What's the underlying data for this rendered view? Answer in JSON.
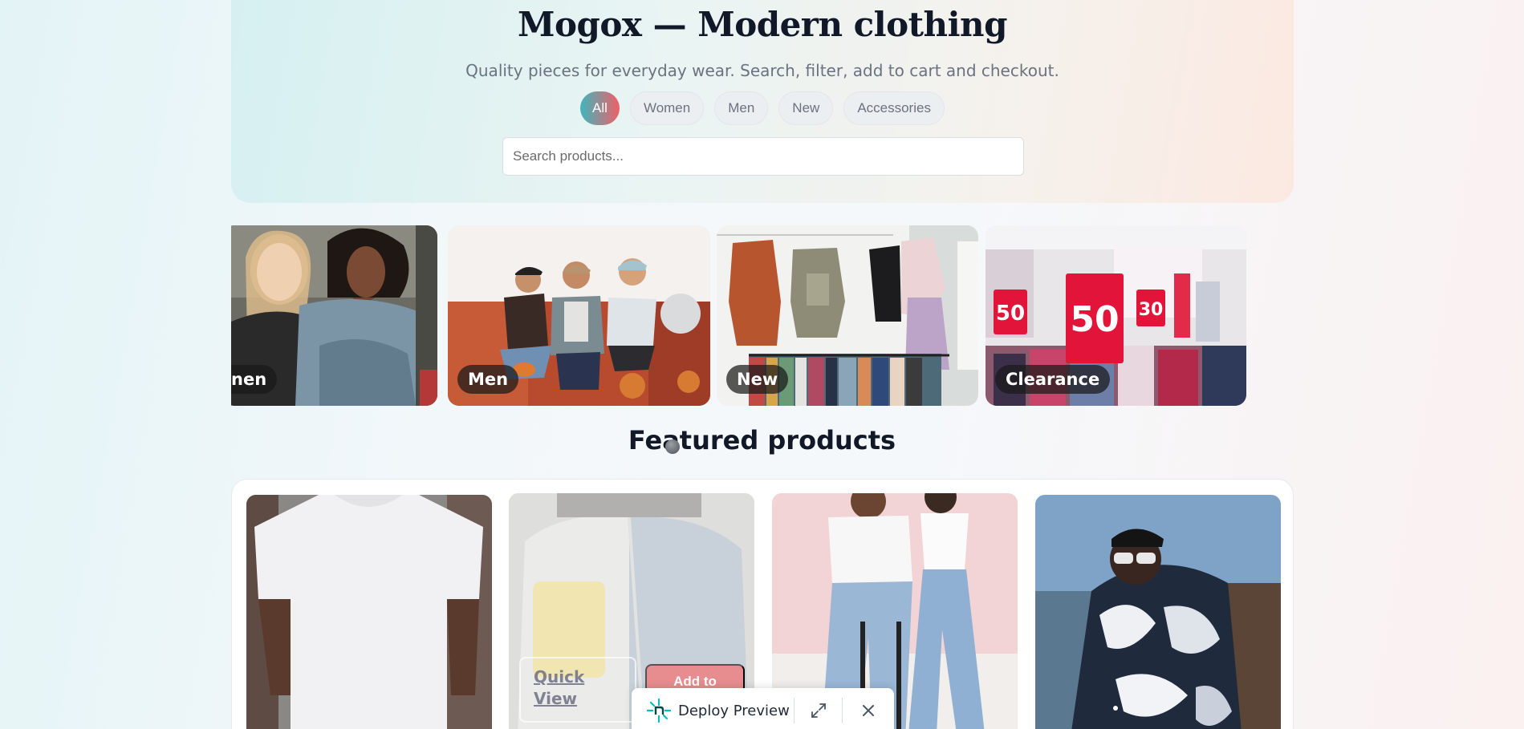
{
  "hero": {
    "title": "Mogox — Modern clothing",
    "subtitle": "Quality pieces for everyday wear. Search, filter, add to cart and checkout.",
    "filters": [
      "All",
      "Women",
      "Men",
      "New",
      "Accessories"
    ],
    "active_filter": "All",
    "search_placeholder": "Search products..."
  },
  "categories": [
    {
      "label": "Women",
      "visible_label": "nen"
    },
    {
      "label": "Men"
    },
    {
      "label": "New"
    },
    {
      "label": "Clearance",
      "sale_signs": [
        "50",
        "50",
        "30"
      ]
    }
  ],
  "featured": {
    "title": "Featured products",
    "hover_actions": {
      "quick_view": "Quick View",
      "add_to_cart": "Add to"
    }
  },
  "deploy_bar": {
    "label": "Deploy Preview",
    "colors": {
      "logo": "#05bdba"
    }
  },
  "colors": {
    "accent_start": "#3fb6bd",
    "accent_end": "#f05f67"
  }
}
